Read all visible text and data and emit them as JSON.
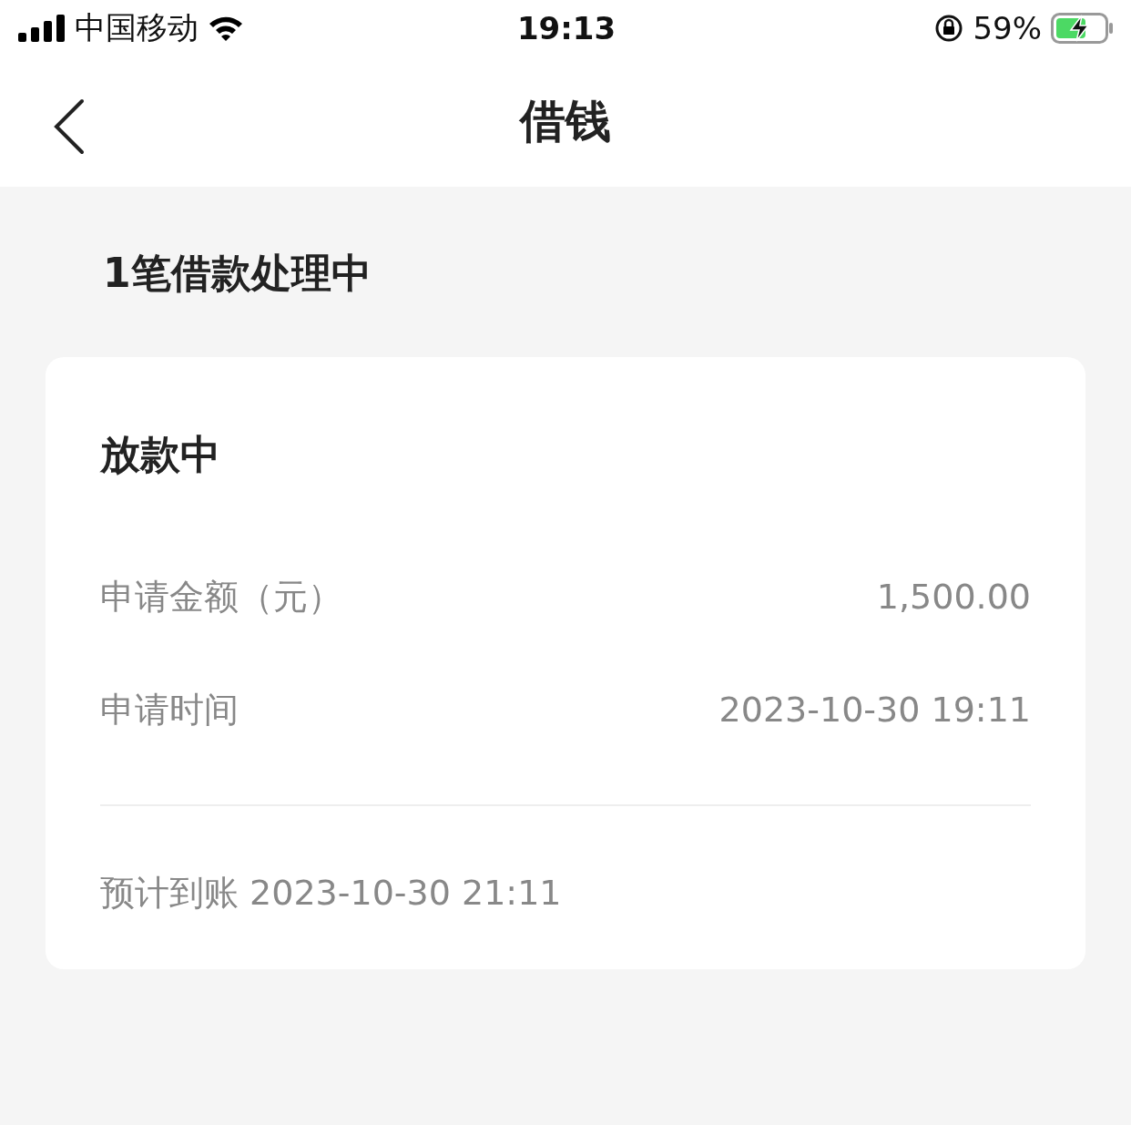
{
  "status_bar": {
    "carrier": "中国移动",
    "time": "19:13",
    "battery_text": "59%"
  },
  "nav": {
    "title": "借钱"
  },
  "summary": "1笔借款处理中",
  "card": {
    "status": "放款中",
    "rows": [
      {
        "label": "申请金额（元）",
        "value": "1,500.00"
      },
      {
        "label": "申请时间",
        "value": "2023-10-30 19:11"
      }
    ],
    "note": "预计到账 2023-10-30 21:11"
  }
}
